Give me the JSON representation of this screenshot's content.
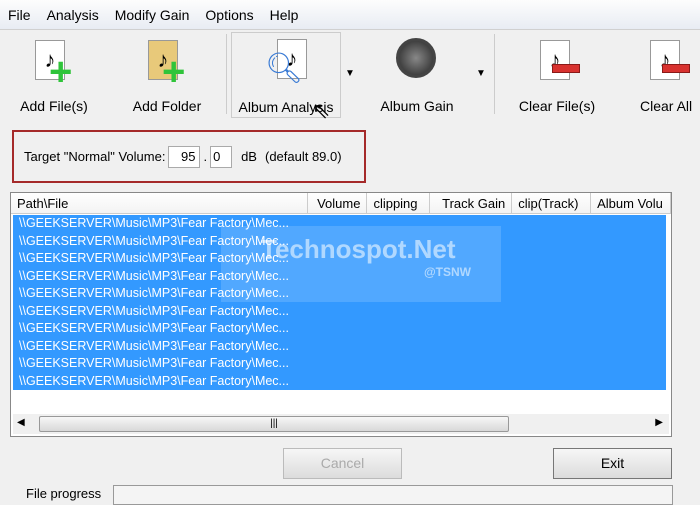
{
  "menu": [
    "File",
    "Analysis",
    "Modify Gain",
    "Options",
    "Help"
  ],
  "toolbar": {
    "add_files": "Add File(s)",
    "add_folder": "Add Folder",
    "album_analysis": "Album Analysis",
    "album_gain": "Album Gain",
    "clear_files": "Clear File(s)",
    "clear_all": "Clear All"
  },
  "target": {
    "label": "Target \"Normal\" Volume:",
    "int_value": "95",
    "dot": ".",
    "dec_value": "0",
    "unit": "dB",
    "default": "(default 89.0)"
  },
  "columns": [
    "Path\\File",
    "Volume",
    "clipping",
    "Track Gain",
    "clip(Track)",
    "Album Volu"
  ],
  "rows": [
    "\\\\GEEKSERVER\\Music\\MP3\\Fear Factory\\Mec...",
    "\\\\GEEKSERVER\\Music\\MP3\\Fear Factory\\Mec...",
    "\\\\GEEKSERVER\\Music\\MP3\\Fear Factory\\Mec...",
    "\\\\GEEKSERVER\\Music\\MP3\\Fear Factory\\Mec...",
    "\\\\GEEKSERVER\\Music\\MP3\\Fear Factory\\Mec...",
    "\\\\GEEKSERVER\\Music\\MP3\\Fear Factory\\Mec...",
    "\\\\GEEKSERVER\\Music\\MP3\\Fear Factory\\Mec...",
    "\\\\GEEKSERVER\\Music\\MP3\\Fear Factory\\Mec...",
    "\\\\GEEKSERVER\\Music\\MP3\\Fear Factory\\Mec...",
    "\\\\GEEKSERVER\\Music\\MP3\\Fear Factory\\Mec..."
  ],
  "watermark": {
    "name": "Technospot.Net",
    "handle": "@TSNW"
  },
  "buttons": {
    "cancel": "Cancel",
    "exit": "Exit"
  },
  "progress": {
    "label": "File progress"
  },
  "colors": {
    "selection": "#3399ff",
    "highlight_border": "#a52a2a"
  }
}
